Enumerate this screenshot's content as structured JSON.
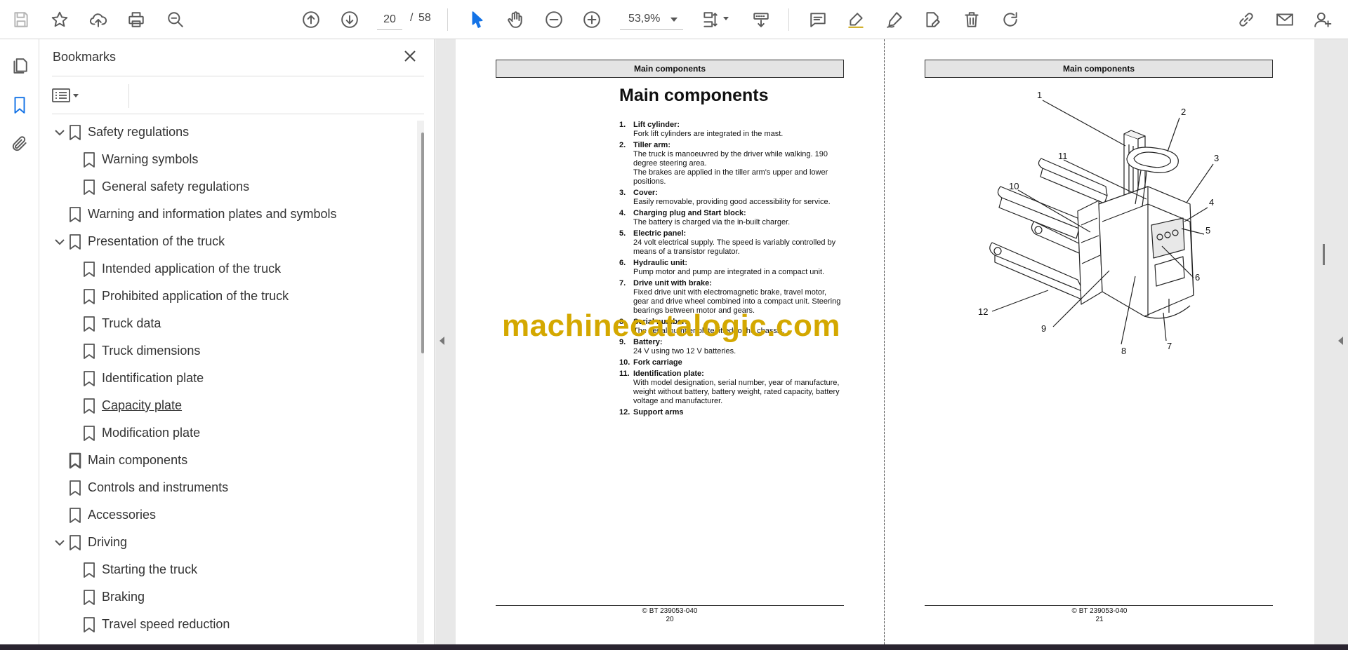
{
  "toolbar": {
    "current_page": "20",
    "page_separator": "/",
    "total_pages": "58",
    "zoom": "53,9%"
  },
  "bookmarks": {
    "title": "Bookmarks",
    "items": [
      {
        "label": "Safety regulations",
        "level": 0,
        "expanded": true
      },
      {
        "label": "Warning symbols",
        "level": 1
      },
      {
        "label": "General safety regulations",
        "level": 1
      },
      {
        "label": "Warning and information plates and symbols",
        "level": 0
      },
      {
        "label": "Presentation of the truck",
        "level": 0,
        "expanded": true
      },
      {
        "label": "Intended application of the truck",
        "level": 1
      },
      {
        "label": "Prohibited application of the truck",
        "level": 1
      },
      {
        "label": "Truck data",
        "level": 1
      },
      {
        "label": "Truck dimensions",
        "level": 1
      },
      {
        "label": "Identification plate",
        "level": 1
      },
      {
        "label": "Capacity plate",
        "level": 1,
        "hovered": true
      },
      {
        "label": "Modification plate",
        "level": 1
      },
      {
        "label": "Main components",
        "level": 0,
        "current": true
      },
      {
        "label": "Controls and instruments",
        "level": 0
      },
      {
        "label": "Accessories",
        "level": 0
      },
      {
        "label": "Driving",
        "level": 0,
        "expanded": true
      },
      {
        "label": "Starting the truck",
        "level": 1
      },
      {
        "label": "Braking",
        "level": 1
      },
      {
        "label": "Travel speed reduction",
        "level": 1
      }
    ]
  },
  "page20": {
    "header": "Main components",
    "title": "Main components",
    "components": [
      {
        "num": "1.",
        "name": "Lift cylinder:",
        "desc": "Fork lift cylinders are integrated in the mast."
      },
      {
        "num": "2.",
        "name": "Tiller arm:",
        "desc": "The truck is manoeuvred by the driver while walking. 190 degree steering area.",
        "desc2": "The brakes are applied in the tiller arm's upper and lower positions."
      },
      {
        "num": "3.",
        "name": "Cover:",
        "desc": "Easily removable, providing good accessibility for service."
      },
      {
        "num": "4.",
        "name": "Charging plug and Start block:",
        "desc": "The battery is charged via the in-built charger."
      },
      {
        "num": "5.",
        "name": "Electric panel:",
        "desc": "24 volt electrical supply. The speed is variably controlled by means of a transistor regulator."
      },
      {
        "num": "6.",
        "name": "Hydraulic unit:",
        "desc": "Pump motor and pump are integrated in a compact unit."
      },
      {
        "num": "7.",
        "name": "Drive unit with brake:",
        "desc": "Fixed drive unit with electromagnetic brake, travel motor, gear and drive wheel combined into a compact unit. Steering bearings between motor and gears."
      },
      {
        "num": "8.",
        "name": "Serial number:",
        "desc": "The serial number plate fitted to the chassis."
      },
      {
        "num": "9.",
        "name": "Battery:",
        "desc": "24 V using two 12 V batteries."
      },
      {
        "num": "10.",
        "name": "Fork carriage",
        "desc": ""
      },
      {
        "num": "11.",
        "name": "Identification plate:",
        "desc": "With model designation, serial number, year of manufacture, weight without battery, battery weight, rated capacity, battery voltage and manufacturer."
      },
      {
        "num": "12.",
        "name": "Support arms",
        "desc": ""
      }
    ],
    "footer_copy": "© BT 239053-040",
    "footer_page": "20"
  },
  "page21": {
    "header": "Main components",
    "callouts": [
      "1",
      "2",
      "3",
      "4",
      "5",
      "6",
      "7",
      "8",
      "9",
      "10",
      "11",
      "12"
    ],
    "footer_copy": "© BT 239053-040",
    "footer_page": "21"
  },
  "watermark": "machinecatalogic.com",
  "colors": {
    "accent": "#1473e6",
    "watermark": "#d4a800",
    "header_bar": "#e4e4e4"
  }
}
